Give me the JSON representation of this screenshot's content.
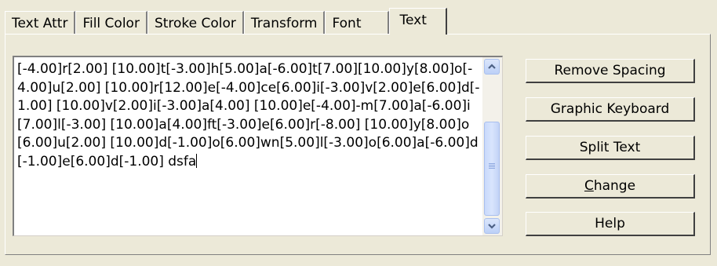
{
  "tabs": [
    {
      "label": "Text Attr",
      "active": false
    },
    {
      "label": "Fill Color",
      "active": false
    },
    {
      "label": "Stroke Color",
      "active": false
    },
    {
      "label": "Transform",
      "active": false
    },
    {
      "label": "Font",
      "active": false
    },
    {
      "label": "Text",
      "active": true
    }
  ],
  "textbox": {
    "value": "[-4.00]r[2.00] [10.00]t[-3.00]h[5.00]a[-6.00]t[7.00][10.00]y[8.00]o[-4.00]u[2.00] [10.00]r[12.00]e[-4.00]ce[6.00]i[-3.00]v[2.00]e[6.00]d[-1.00] [10.00]v[2.00]i[-3.00]a[4.00] [10.00]e[-4.00]-m[7.00]a[-6.00]i[7.00]l[-3.00] [10.00]a[4.00]ft[-3.00]e[6.00]r[-8.00] [10.00]y[8.00]o[6.00]u[2.00] [10.00]d[-1.00]o[6.00]wn[5.00]l[-3.00]o[6.00]a[-6.00]d[-1.00]e[6.00]d[-1.00] dsfa"
  },
  "buttons": {
    "remove_spacing": "Remove Spacing",
    "graphic_keyboard": "Graphic Keyboard",
    "split_text": "Split Text",
    "change_mnemonic": "C",
    "change_rest": "hange",
    "help": "Help"
  },
  "colors": {
    "panel_bg": "#ece9d8",
    "scroll_button": "#bcd0f7"
  }
}
